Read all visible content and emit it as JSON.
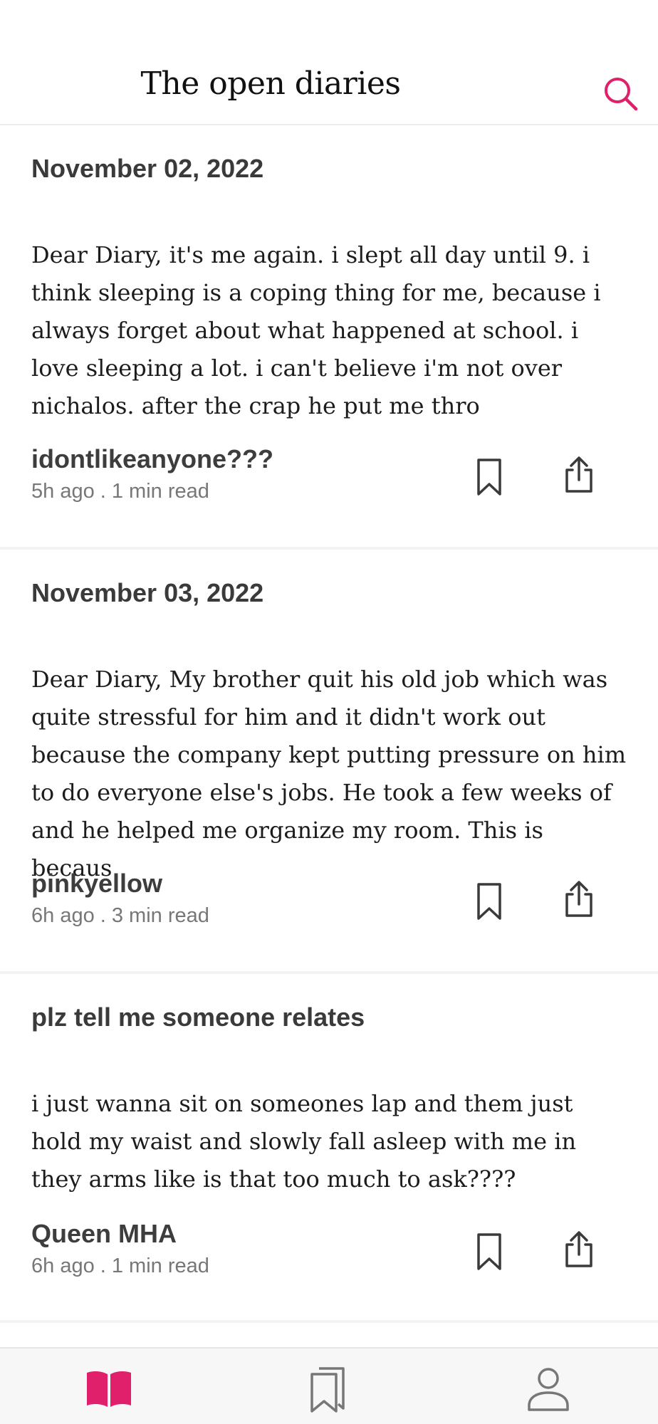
{
  "app": {
    "title": "The open diaries"
  },
  "colors": {
    "accent": "#e0206b",
    "icon_gray": "#555555"
  },
  "icons": {
    "search": "search-icon",
    "bookmark": "bookmark-icon",
    "share": "share-icon",
    "tab_diaries": "open-book-icon",
    "tab_saved": "bookmarks-icon",
    "tab_profile": "user-icon"
  },
  "posts": [
    {
      "title": "November 02, 2022",
      "body": "Dear Diary,   it's me again. i slept all day until 9. i think sleeping is a coping thing for me, because i always forget about what happened at school. i love sleeping a lot. i can't believe i'm not over nichalos. after the crap he put me thro",
      "author": "idontlikeanyone???",
      "meta": "5h ago . 1 min read"
    },
    {
      "title": "November 03, 2022",
      "body": "Dear Diary, My brother quit his old job which was quite stressful for him and it didn't work out because the company kept putting pressure on him to do everyone else's jobs.  He took a few weeks of and he helped me organize my room.  This is becaus",
      "author": "pinkyellow",
      "meta": "6h ago . 3 min read"
    },
    {
      "title": "plz tell me someone relates",
      "body": "i just wanna sit on someones lap and them just hold my waist and slowly fall asleep with me in they arms like is that too much to ask????",
      "author": "Queen MHA",
      "meta": "6h ago . 1 min read"
    }
  ]
}
